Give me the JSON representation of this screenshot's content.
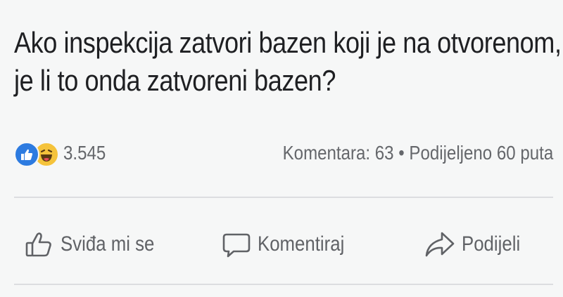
{
  "post": {
    "text_line1": "Ako inspekcija zatvori bazen koji je na otvorenom,",
    "text_line2": "je li to onda zatvoreni bazen?"
  },
  "stats": {
    "reaction_count": "3.545",
    "reactions": [
      "like-icon",
      "haha-icon"
    ],
    "comments_shares": "Komentara: 63 • Podijeljeno 60 puta"
  },
  "actions": {
    "like_label": "Sviđa mi se",
    "comment_label": "Komentiraj",
    "share_label": "Podijeli"
  },
  "colors": {
    "like_blue": "#2d7be0",
    "haha_yellow": "#f5c33b",
    "secondary_text": "#65676b",
    "background": "#f6f7f7"
  }
}
